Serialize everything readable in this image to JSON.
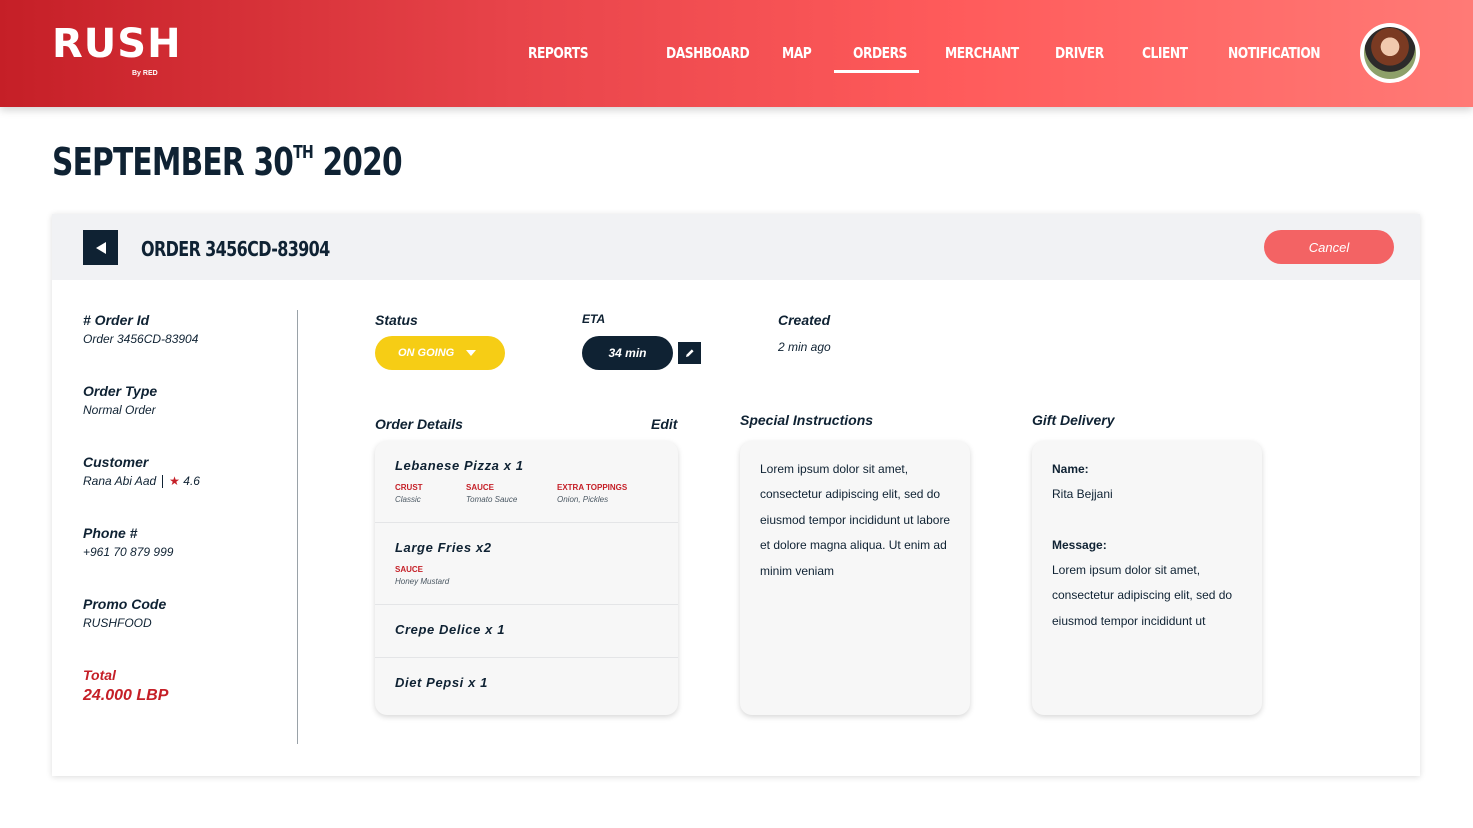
{
  "brand": {
    "name": "RUSH",
    "tagline": "By RED"
  },
  "nav": {
    "items": [
      {
        "label": "REPORTS"
      },
      {
        "label": "DASHBOARD"
      },
      {
        "label": "MAP"
      },
      {
        "label": "ORDERS"
      },
      {
        "label": "MERCHANT"
      },
      {
        "label": "DRIVER"
      },
      {
        "label": "CLIENT"
      },
      {
        "label": "NOTIFICATION"
      }
    ],
    "active": "ORDERS"
  },
  "page": {
    "date_main": "SEPTEMBER 30",
    "date_sup": "TH",
    "date_year": "2020"
  },
  "order": {
    "title": "ORDER 3456CD-83904",
    "cancel_label": "Cancel",
    "info": {
      "order_id_label": "# Order Id",
      "order_id_value": "Order 3456CD-83904",
      "order_type_label": "Order Type",
      "order_type_value": "Normal Order",
      "customer_label": "Customer",
      "customer_name": "Rana Abi Aad",
      "customer_rating": "4.6",
      "phone_label": "Phone #",
      "phone_value": "+961 70 879 999",
      "promo_label": "Promo Code",
      "promo_value": "RUSHFOOD",
      "total_label": "Total",
      "total_value": "24.000 LBP"
    },
    "status_label": "Status",
    "status_value": "ON GOING",
    "eta_label": "ETA",
    "eta_value": "34 min",
    "created_label": "Created",
    "created_value": "2 min ago",
    "details_label": "Order Details",
    "edit_label": "Edit",
    "items": [
      {
        "name": "Lebanese Pizza x 1",
        "options": [
          {
            "key": "CRUST",
            "value": "Classic"
          },
          {
            "key": "SAUCE",
            "value": "Tomato Sauce"
          },
          {
            "key": "EXTRA TOPPINGS",
            "value": "Onion, Pickles"
          }
        ]
      },
      {
        "name": "Large Fries x2",
        "options": [
          {
            "key": "SAUCE",
            "value": "Honey Mustard"
          }
        ]
      },
      {
        "name": "Crepe Delice x 1",
        "options": []
      },
      {
        "name": "Diet Pepsi x 1",
        "options": []
      }
    ],
    "special_label": "Special Instructions",
    "special_text": "Lorem ipsum dolor sit amet, consectetur adipiscing elit, sed do eiusmod tempor incididunt ut labore et dolore magna aliqua. Ut enim ad minim veniam",
    "gift_label": "Gift Delivery",
    "gift_name_label": "Name:",
    "gift_name_value": "Rita Bejjani",
    "gift_message_label": "Message:",
    "gift_message_value": "Lorem ipsum dolor sit amet, consectetur adipiscing elit, sed do eiusmod tempor incididunt ut"
  },
  "colors": {
    "brand_red": "#c51f27",
    "navy": "#0f2233",
    "status_yellow": "#f6cd15",
    "cancel_red": "#f36364"
  },
  "icons": {
    "back": "caret-left-icon",
    "edit": "pencil-icon",
    "rating": "star-icon",
    "status_dropdown": "caret-down-icon"
  }
}
